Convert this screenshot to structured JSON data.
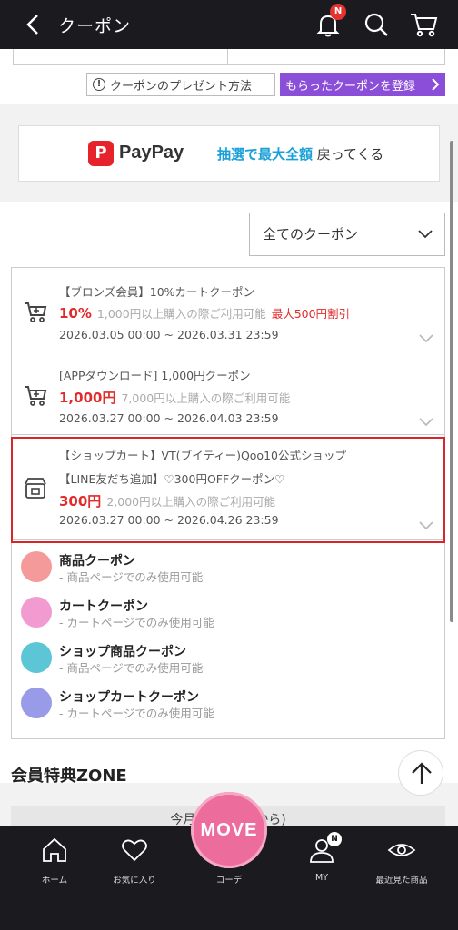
{
  "header": {
    "title": "クーポン",
    "notification_badge": "N"
  },
  "actions": {
    "present_label": "クーポンのプレゼント方法",
    "register_label": "もらったクーポンを登録"
  },
  "banner": {
    "brand": "PayPay",
    "promo_highlight": "抽選で最大全額",
    "promo_rest": "戻ってくる"
  },
  "filter": {
    "selected": "全てのクーポン"
  },
  "coupons": [
    {
      "name": "【ブロンズ会員】10%カートクーポン",
      "amount": "10%",
      "condition": "1,000円以上購入の際ご利用可能",
      "max": "最大500円割引",
      "period": "2026.03.05 00:00 ~ 2026.03.31 23:59",
      "icon": "cart-coupon-icon"
    },
    {
      "name": "[APPダウンロード] 1,000円クーポン",
      "amount": "1,000円",
      "condition": "7,000円以上購入の際ご利用可能",
      "period": "2026.03.27 00:00 ~ 2026.04.03 23:59",
      "icon": "cart-coupon-icon"
    },
    {
      "shop": "【ショップカート】VT(ブイティー)Qoo10公式ショップ",
      "name": "【LINE友だち追加】♡300円OFFクーポン♡",
      "amount": "300円",
      "condition": "2,000円以上購入の際ご利用可能",
      "period": "2026.03.27 00:00 ~ 2026.04.26 23:59",
      "icon": "shop-cart-icon"
    }
  ],
  "legend": [
    {
      "title": "商品クーポン",
      "sub": "- 商品ページでのみ使用可能",
      "color": "#f59a9a"
    },
    {
      "title": "カートクーポン",
      "sub": "- カートページでのみ使用可能",
      "color": "#f29bd0"
    },
    {
      "title": "ショップ商品クーポン",
      "sub": "- 商品ページでのみ使用可能",
      "color": "#5cc6d6"
    },
    {
      "title": "ショップカートクーポン",
      "sub": "- カートページでのみ使用可能",
      "color": "#9a9be8"
    }
  ],
  "zone": {
    "title": "会員特典ZONE",
    "card_text": "今月の特典 (月から)"
  },
  "bottom_nav": {
    "home": "ホーム",
    "favorites": "お気に入り",
    "coordinate": "コーデ",
    "move": "MOVE",
    "my": "MY",
    "my_badge": "N",
    "recent": "最近見た商品"
  }
}
